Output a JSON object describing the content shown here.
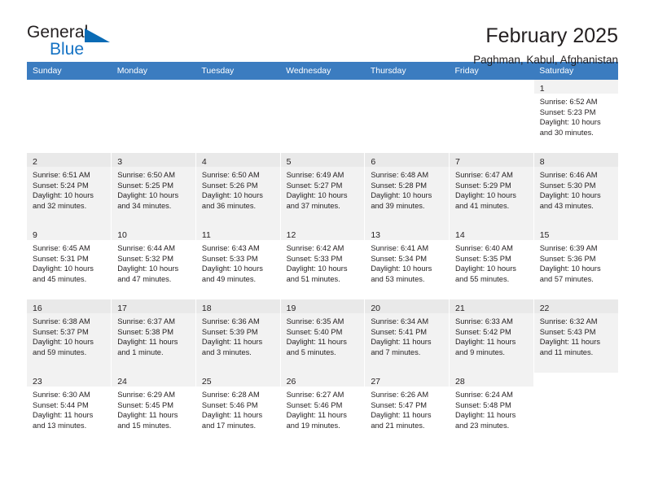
{
  "brand": {
    "name_top": "General",
    "name_bottom": "Blue",
    "triangle_color": "#0a6bb5",
    "blue_text_color": "#1472c4"
  },
  "header": {
    "title": "February 2025",
    "subtitle": "Paghman, Kabul, Afghanistan"
  },
  "theme": {
    "header_row_bg": "#3b7cc0",
    "header_row_text": "#ffffff",
    "shaded_row_bg": "#f2f2f2",
    "daynum_bar_bg": "#f2f2f2",
    "text_color": "#231f20"
  },
  "weekday_headers": [
    "Sunday",
    "Monday",
    "Tuesday",
    "Wednesday",
    "Thursday",
    "Friday",
    "Saturday"
  ],
  "labels": {
    "sunrise": "Sunrise:",
    "sunset": "Sunset:",
    "daylight": "Daylight:"
  },
  "weeks": [
    {
      "shaded": false,
      "days": [
        {
          "day": "",
          "sunrise": "",
          "sunset": "",
          "daylight": ""
        },
        {
          "day": "",
          "sunrise": "",
          "sunset": "",
          "daylight": ""
        },
        {
          "day": "",
          "sunrise": "",
          "sunset": "",
          "daylight": ""
        },
        {
          "day": "",
          "sunrise": "",
          "sunset": "",
          "daylight": ""
        },
        {
          "day": "",
          "sunrise": "",
          "sunset": "",
          "daylight": ""
        },
        {
          "day": "",
          "sunrise": "",
          "sunset": "",
          "daylight": ""
        },
        {
          "day": "1",
          "sunrise": "Sunrise: 6:52 AM",
          "sunset": "Sunset: 5:23 PM",
          "daylight": "Daylight: 10 hours and 30 minutes."
        }
      ]
    },
    {
      "shaded": true,
      "days": [
        {
          "day": "2",
          "sunrise": "Sunrise: 6:51 AM",
          "sunset": "Sunset: 5:24 PM",
          "daylight": "Daylight: 10 hours and 32 minutes."
        },
        {
          "day": "3",
          "sunrise": "Sunrise: 6:50 AM",
          "sunset": "Sunset: 5:25 PM",
          "daylight": "Daylight: 10 hours and 34 minutes."
        },
        {
          "day": "4",
          "sunrise": "Sunrise: 6:50 AM",
          "sunset": "Sunset: 5:26 PM",
          "daylight": "Daylight: 10 hours and 36 minutes."
        },
        {
          "day": "5",
          "sunrise": "Sunrise: 6:49 AM",
          "sunset": "Sunset: 5:27 PM",
          "daylight": "Daylight: 10 hours and 37 minutes."
        },
        {
          "day": "6",
          "sunrise": "Sunrise: 6:48 AM",
          "sunset": "Sunset: 5:28 PM",
          "daylight": "Daylight: 10 hours and 39 minutes."
        },
        {
          "day": "7",
          "sunrise": "Sunrise: 6:47 AM",
          "sunset": "Sunset: 5:29 PM",
          "daylight": "Daylight: 10 hours and 41 minutes."
        },
        {
          "day": "8",
          "sunrise": "Sunrise: 6:46 AM",
          "sunset": "Sunset: 5:30 PM",
          "daylight": "Daylight: 10 hours and 43 minutes."
        }
      ]
    },
    {
      "shaded": false,
      "days": [
        {
          "day": "9",
          "sunrise": "Sunrise: 6:45 AM",
          "sunset": "Sunset: 5:31 PM",
          "daylight": "Daylight: 10 hours and 45 minutes."
        },
        {
          "day": "10",
          "sunrise": "Sunrise: 6:44 AM",
          "sunset": "Sunset: 5:32 PM",
          "daylight": "Daylight: 10 hours and 47 minutes."
        },
        {
          "day": "11",
          "sunrise": "Sunrise: 6:43 AM",
          "sunset": "Sunset: 5:33 PM",
          "daylight": "Daylight: 10 hours and 49 minutes."
        },
        {
          "day": "12",
          "sunrise": "Sunrise: 6:42 AM",
          "sunset": "Sunset: 5:33 PM",
          "daylight": "Daylight: 10 hours and 51 minutes."
        },
        {
          "day": "13",
          "sunrise": "Sunrise: 6:41 AM",
          "sunset": "Sunset: 5:34 PM",
          "daylight": "Daylight: 10 hours and 53 minutes."
        },
        {
          "day": "14",
          "sunrise": "Sunrise: 6:40 AM",
          "sunset": "Sunset: 5:35 PM",
          "daylight": "Daylight: 10 hours and 55 minutes."
        },
        {
          "day": "15",
          "sunrise": "Sunrise: 6:39 AM",
          "sunset": "Sunset: 5:36 PM",
          "daylight": "Daylight: 10 hours and 57 minutes."
        }
      ]
    },
    {
      "shaded": true,
      "days": [
        {
          "day": "16",
          "sunrise": "Sunrise: 6:38 AM",
          "sunset": "Sunset: 5:37 PM",
          "daylight": "Daylight: 10 hours and 59 minutes."
        },
        {
          "day": "17",
          "sunrise": "Sunrise: 6:37 AM",
          "sunset": "Sunset: 5:38 PM",
          "daylight": "Daylight: 11 hours and 1 minute."
        },
        {
          "day": "18",
          "sunrise": "Sunrise: 6:36 AM",
          "sunset": "Sunset: 5:39 PM",
          "daylight": "Daylight: 11 hours and 3 minutes."
        },
        {
          "day": "19",
          "sunrise": "Sunrise: 6:35 AM",
          "sunset": "Sunset: 5:40 PM",
          "daylight": "Daylight: 11 hours and 5 minutes."
        },
        {
          "day": "20",
          "sunrise": "Sunrise: 6:34 AM",
          "sunset": "Sunset: 5:41 PM",
          "daylight": "Daylight: 11 hours and 7 minutes."
        },
        {
          "day": "21",
          "sunrise": "Sunrise: 6:33 AM",
          "sunset": "Sunset: 5:42 PM",
          "daylight": "Daylight: 11 hours and 9 minutes."
        },
        {
          "day": "22",
          "sunrise": "Sunrise: 6:32 AM",
          "sunset": "Sunset: 5:43 PM",
          "daylight": "Daylight: 11 hours and 11 minutes."
        }
      ]
    },
    {
      "shaded": false,
      "days": [
        {
          "day": "23",
          "sunrise": "Sunrise: 6:30 AM",
          "sunset": "Sunset: 5:44 PM",
          "daylight": "Daylight: 11 hours and 13 minutes."
        },
        {
          "day": "24",
          "sunrise": "Sunrise: 6:29 AM",
          "sunset": "Sunset: 5:45 PM",
          "daylight": "Daylight: 11 hours and 15 minutes."
        },
        {
          "day": "25",
          "sunrise": "Sunrise: 6:28 AM",
          "sunset": "Sunset: 5:46 PM",
          "daylight": "Daylight: 11 hours and 17 minutes."
        },
        {
          "day": "26",
          "sunrise": "Sunrise: 6:27 AM",
          "sunset": "Sunset: 5:46 PM",
          "daylight": "Daylight: 11 hours and 19 minutes."
        },
        {
          "day": "27",
          "sunrise": "Sunrise: 6:26 AM",
          "sunset": "Sunset: 5:47 PM",
          "daylight": "Daylight: 11 hours and 21 minutes."
        },
        {
          "day": "28",
          "sunrise": "Sunrise: 6:24 AM",
          "sunset": "Sunset: 5:48 PM",
          "daylight": "Daylight: 11 hours and 23 minutes."
        },
        {
          "day": "",
          "sunrise": "",
          "sunset": "",
          "daylight": ""
        }
      ]
    }
  ]
}
